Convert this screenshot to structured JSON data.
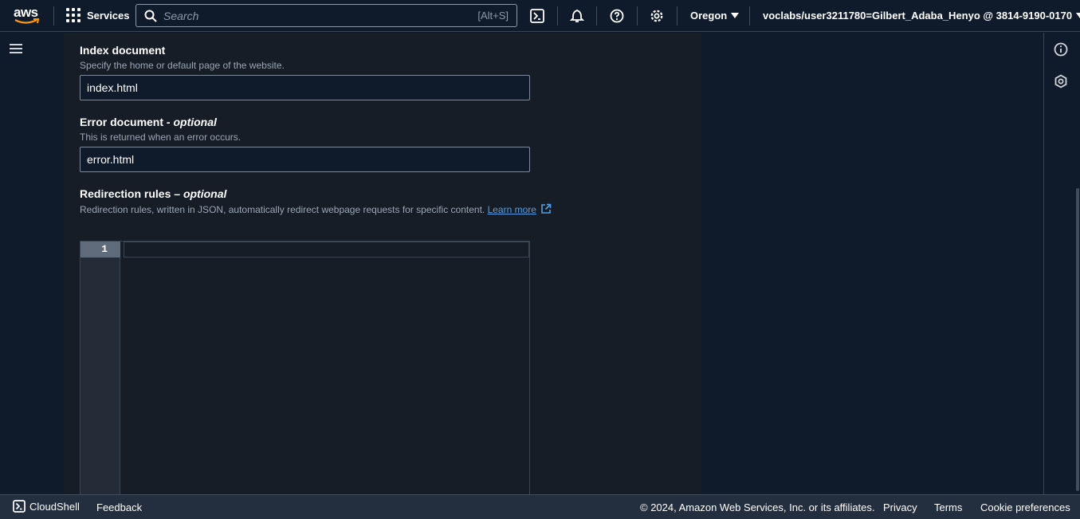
{
  "topnav": {
    "logo_text": "aws",
    "services_label": "Services",
    "search_placeholder": "Search",
    "search_shortcut": "[Alt+S]",
    "region": "Oregon",
    "account": "voclabs/user3211780=Gilbert_Adaba_Henyo @ 3814-9190-0170",
    "icons": [
      "cloudshell-icon",
      "bell-icon",
      "help-icon",
      "settings-icon"
    ]
  },
  "form": {
    "index": {
      "label": "Index document",
      "description": "Specify the home or default page of the website.",
      "value": "index.html"
    },
    "error": {
      "label": "Error document",
      "optional": "optional",
      "description": "This is returned when an error occurs.",
      "value": "error.html"
    },
    "redirect": {
      "label": "Redirection rules –",
      "optional": "optional",
      "description": "Redirection rules, written in JSON, automatically redirect webpage requests for specific content.",
      "learn_more": "Learn more",
      "line_number": "1"
    }
  },
  "footer": {
    "cloudshell": "CloudShell",
    "feedback": "Feedback",
    "copyright": "© 2024, Amazon Web Services, Inc. or its affiliates.",
    "privacy": "Privacy",
    "terms": "Terms",
    "cookies": "Cookie preferences"
  },
  "colors": {
    "nav_bg": "#0f1b2a",
    "panel_bg": "#161d26",
    "link": "#539fe5",
    "footer_bg": "#232f3e"
  }
}
